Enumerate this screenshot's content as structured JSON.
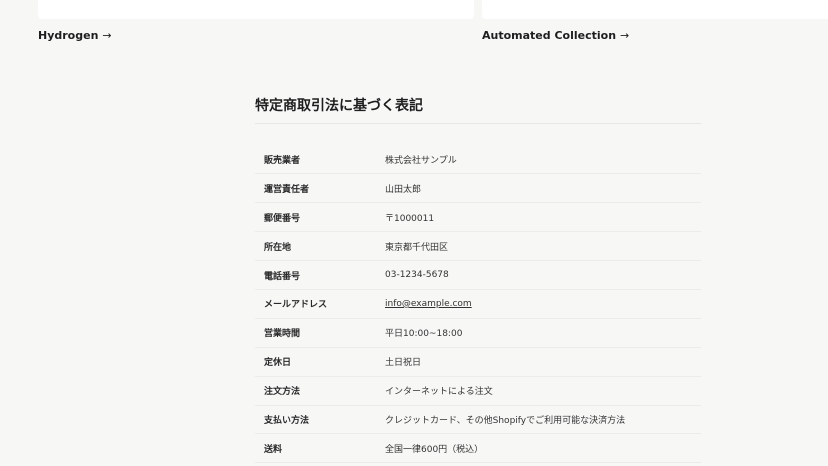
{
  "collections": [
    {
      "label": "Hydrogen",
      "arrow": "→"
    },
    {
      "label": "Automated Collection",
      "arrow": "→"
    }
  ],
  "legal": {
    "title": "特定商取引法に基づく表記",
    "rows": [
      {
        "label": "販売業者",
        "value": "株式会社サンプル"
      },
      {
        "label": "運営責任者",
        "value": "山田太郎"
      },
      {
        "label": "郵便番号",
        "value": "〒1000011"
      },
      {
        "label": "所在地",
        "value": "東京都千代田区"
      },
      {
        "label": "電話番号",
        "value": "03-1234-5678"
      },
      {
        "label": "メールアドレス",
        "value": "info@example.com"
      },
      {
        "label": "営業時間",
        "value": "平日10:00~18:00"
      },
      {
        "label": "定休日",
        "value": "土日祝日"
      },
      {
        "label": "注文方法",
        "value": "インターネットによる注文"
      },
      {
        "label": "支払い方法",
        "value": "クレジットカード、その他Shopifyでご利用可能な決済方法"
      },
      {
        "label": "送料",
        "value": "全国一律600円（税込）"
      }
    ]
  }
}
